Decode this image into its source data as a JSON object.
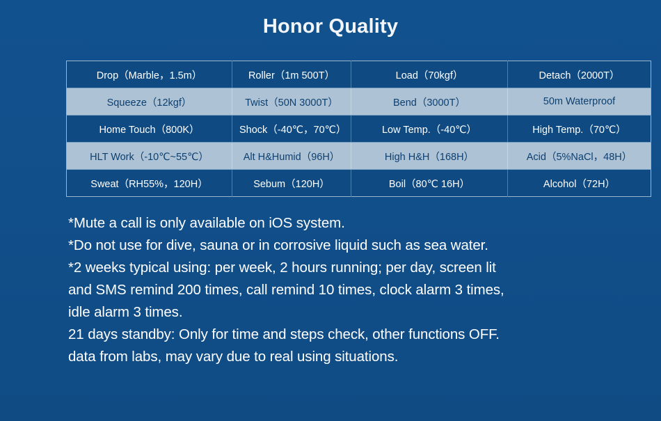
{
  "page": {
    "title": "Honor Quality",
    "background_color": "#12518c",
    "title_color": "#f2f6fa"
  },
  "spec_table": {
    "accent_dark_row": "#0f4a82",
    "accent_light_row": "#adc3d5",
    "border_color": "#9ab6cd",
    "rows": [
      {
        "style": "dark",
        "cells": [
          "Drop（Marble，1.5m）",
          "Roller（1m 500T）",
          "Load（70kgf）",
          "Detach（2000T）"
        ]
      },
      {
        "style": "light",
        "cells": [
          "Squeeze（12kgf）",
          "Twist（50N 3000T）",
          "Bend（3000T）",
          "50m Waterproof"
        ]
      },
      {
        "style": "dark",
        "cells": [
          "Home Touch（800K）",
          "Shock（-40℃，70℃）",
          "Low Temp.（-40℃）",
          "High Temp.（70℃）"
        ]
      },
      {
        "style": "light",
        "cells": [
          "HLT Work（-10℃~55℃）",
          "Alt H&Humid（96H）",
          "High H&H（168H）",
          "Acid（5%NaCl，48H）"
        ]
      },
      {
        "style": "dark",
        "cells": [
          "Sweat（RH55%，120H）",
          "Sebum（120H）",
          "Boil（80℃ 16H）",
          "Alcohol（72H）"
        ]
      }
    ]
  },
  "notes": {
    "lines": [
      "*Mute a call is only available on iOS system.",
      "*Do not use for dive, sauna or in corrosive liquid such as sea water.",
      "*2 weeks typical using: per week, 2 hours running; per day, screen lit",
      "and SMS remind 200 times, call remind 10 times, clock alarm 3 times,",
      "idle alarm 3 times.",
      "21 days standby: Only for time and steps check, other functions OFF.",
      "data from labs, may vary due to real using situations."
    ]
  }
}
